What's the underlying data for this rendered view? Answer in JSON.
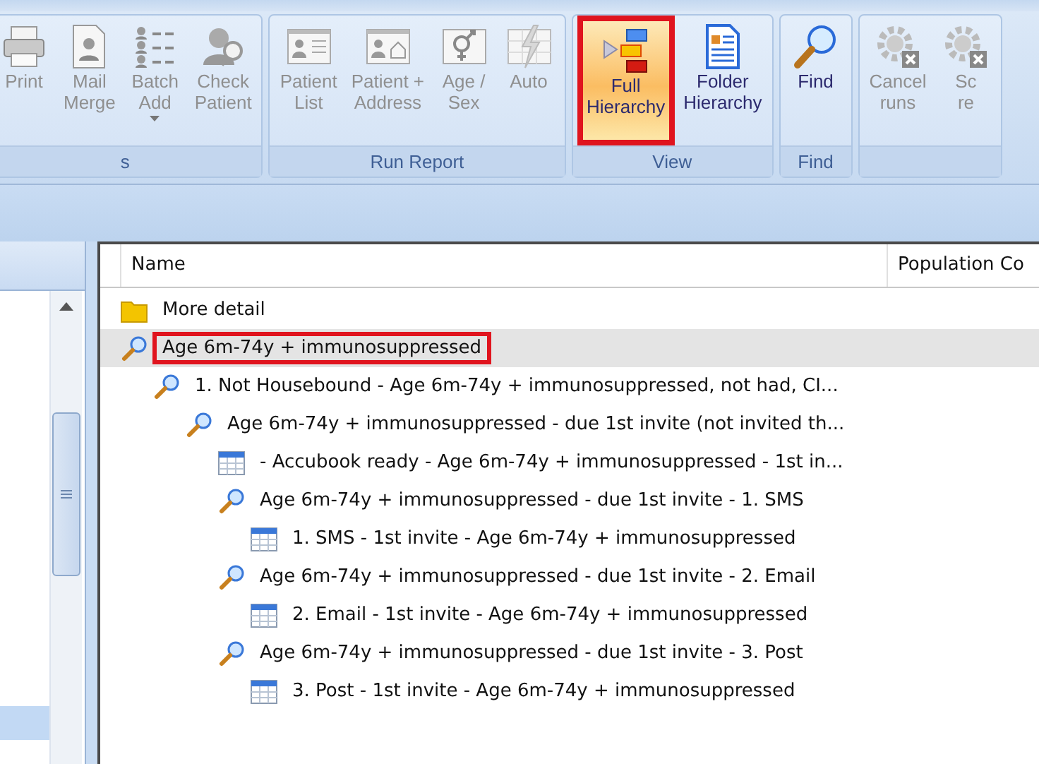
{
  "ribbon": {
    "groups": [
      {
        "label": "s",
        "buttons": [
          {
            "kind": "printer",
            "label": [
              "Print"
            ],
            "disabled": true,
            "dropdown": false,
            "selected": false,
            "highlighted": false
          },
          {
            "kind": "merge",
            "label": [
              "Mail",
              "Merge"
            ],
            "disabled": true,
            "dropdown": false,
            "selected": false,
            "highlighted": false
          },
          {
            "kind": "batch",
            "label": [
              "Batch",
              "Add"
            ],
            "disabled": true,
            "dropdown": true,
            "selected": false,
            "highlighted": false
          },
          {
            "kind": "check",
            "label": [
              "Check",
              "Patient"
            ],
            "disabled": true,
            "dropdown": false,
            "selected": false,
            "highlighted": false
          }
        ]
      },
      {
        "label": "Run Report",
        "buttons": [
          {
            "kind": "list",
            "label": [
              "Patient",
              "List"
            ],
            "disabled": true,
            "dropdown": false,
            "selected": false,
            "highlighted": false
          },
          {
            "kind": "address",
            "label": [
              "Patient +",
              "Address"
            ],
            "disabled": true,
            "dropdown": false,
            "selected": false,
            "highlighted": false
          },
          {
            "kind": "sex",
            "label": [
              "Age /",
              "Sex"
            ],
            "disabled": true,
            "dropdown": false,
            "selected": false,
            "highlighted": false
          },
          {
            "kind": "auto",
            "label": [
              "Auto"
            ],
            "disabled": true,
            "dropdown": false,
            "selected": false,
            "highlighted": false
          }
        ]
      },
      {
        "label": "View",
        "buttons": [
          {
            "kind": "hierarchy",
            "label": [
              "Full",
              "Hierarchy"
            ],
            "disabled": false,
            "dropdown": false,
            "selected": true,
            "highlighted": true
          },
          {
            "kind": "folder",
            "label": [
              "Folder",
              "Hierarchy"
            ],
            "disabled": false,
            "dropdown": false,
            "selected": false,
            "highlighted": false
          }
        ]
      },
      {
        "label": "Find",
        "buttons": [
          {
            "kind": "find",
            "label": [
              "Find"
            ],
            "disabled": false,
            "dropdown": false,
            "selected": false,
            "highlighted": false
          }
        ]
      },
      {
        "buttons": [
          {
            "kind": "cancel",
            "label": [
              "Cancel",
              "runs"
            ],
            "disabled": true,
            "dropdown": false,
            "selected": false,
            "highlighted": false
          },
          {
            "kind": "cancel",
            "label": [
              "Sc",
              "re"
            ],
            "disabled": true,
            "dropdown": false,
            "selected": false,
            "highlighted": false
          }
        ]
      }
    ]
  },
  "tree": {
    "columns": [
      "Name",
      "Population Co"
    ],
    "items": [
      {
        "kind": "folder",
        "label": "More detail",
        "selected": false,
        "highlighted": false
      },
      {
        "kind": "query",
        "label": "Age 6m-74y + immunosuppressed",
        "selected": true,
        "highlighted": true,
        "children": [
          {
            "kind": "query",
            "label": "1. Not Housebound - Age 6m-74y + immunosuppressed, not had, CI...",
            "selected": false,
            "highlighted": false,
            "children": [
              {
                "kind": "query",
                "label": "Age 6m-74y + immunosuppressed - due 1st invite (not invited th...",
                "selected": false,
                "highlighted": false,
                "children": [
                  {
                    "kind": "report",
                    "label": "- Accubook ready - Age 6m-74y + immunosuppressed - 1st in...",
                    "selected": false,
                    "highlighted": false
                  },
                  {
                    "kind": "query",
                    "label": "Age 6m-74y + immunosuppressed - due 1st invite - 1. SMS",
                    "selected": false,
                    "highlighted": false,
                    "children": [
                      {
                        "kind": "report",
                        "label": "1. SMS - 1st invite - Age 6m-74y + immunosuppressed",
                        "selected": false,
                        "highlighted": false
                      }
                    ]
                  },
                  {
                    "kind": "query",
                    "label": "Age 6m-74y + immunosuppressed - due 1st invite - 2. Email",
                    "selected": false,
                    "highlighted": false,
                    "children": [
                      {
                        "kind": "report",
                        "label": "2. Email - 1st invite - Age 6m-74y + immunosuppressed",
                        "selected": false,
                        "highlighted": false
                      }
                    ]
                  },
                  {
                    "kind": "query",
                    "label": "Age 6m-74y + immunosuppressed - due 1st invite - 3. Post",
                    "selected": false,
                    "highlighted": false,
                    "children": [
                      {
                        "kind": "report",
                        "label": "3. Post - 1st invite - Age 6m-74y + immunosuppressed",
                        "selected": false,
                        "highlighted": false
                      }
                    ]
                  }
                ]
              }
            ]
          }
        ]
      }
    ]
  },
  "side_panel": {
    "selected_row": true
  }
}
